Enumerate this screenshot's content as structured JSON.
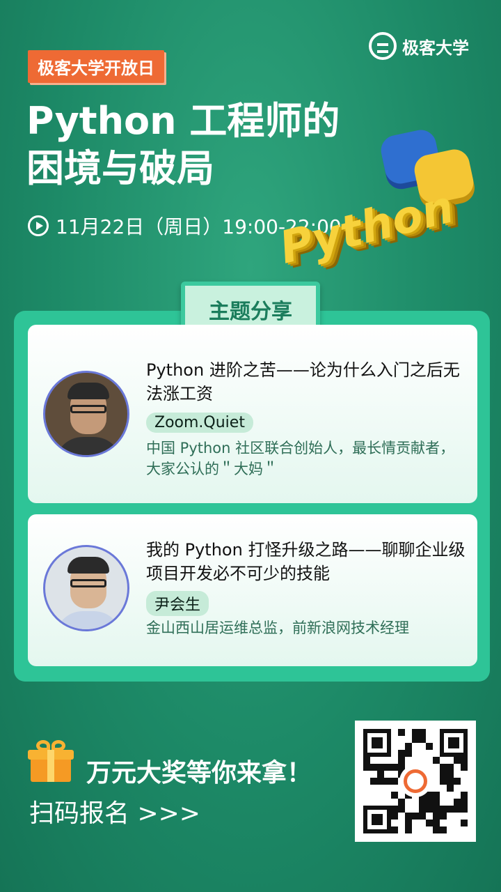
{
  "brand": {
    "logo_text": "极客大学"
  },
  "hero": {
    "event_tag": "极客大学开放日",
    "headline_line1": "Python 工程师的",
    "headline_line2": "困境与破局",
    "datetime": "11月22日（周日）19:00-22:00",
    "art_word": "Python"
  },
  "section": {
    "title": "主题分享"
  },
  "talks": [
    {
      "title": "Python 进阶之苦——论为什么入门之后无法涨工资",
      "speaker": "Zoom.Quiet",
      "bio": "中国 Python 社区联合创始人，最长情贡献者，大家公认的＂大妈＂"
    },
    {
      "title": "我的 Python 打怪升级之路——聊聊企业级项目开发必不可少的技能",
      "speaker": "尹会生",
      "bio": "金山西山居运维总监，前新浪网技术经理"
    }
  ],
  "footer": {
    "prize_text": "万元大奖等你来拿！",
    "register_text": "扫码报名 >>>"
  },
  "colors": {
    "background": "#1d8a67",
    "accent_orange": "#ee6a34",
    "panel_green": "#2ec497",
    "bio_text": "#2f6e57"
  },
  "icons": [
    "logo-icon",
    "clock-icon",
    "gift-icon",
    "qr-code"
  ]
}
